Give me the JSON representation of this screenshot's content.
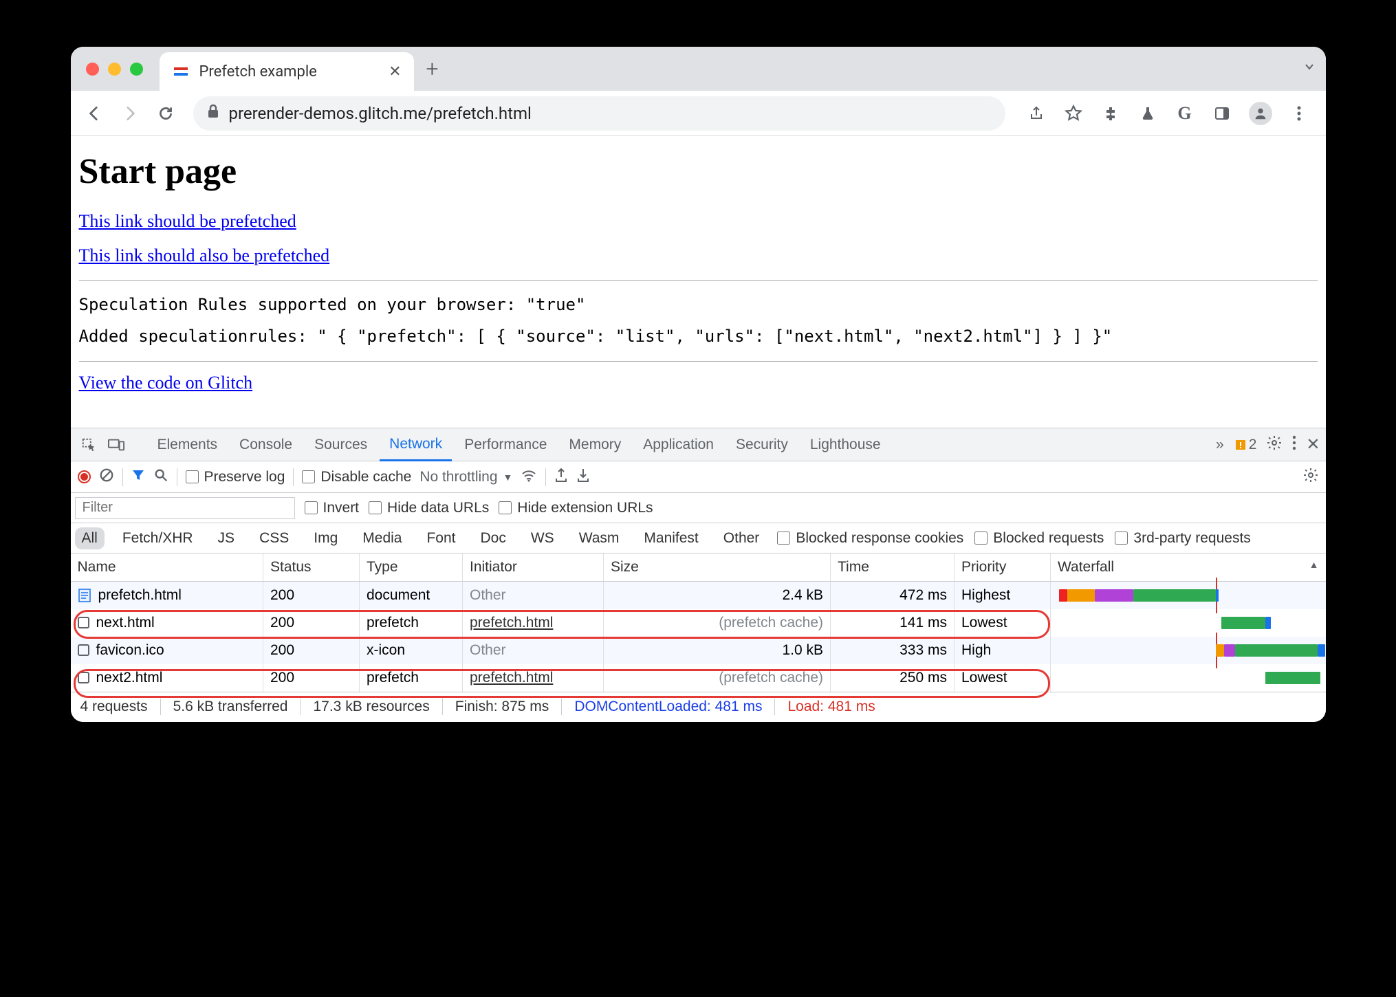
{
  "tab": {
    "title": "Prefetch example"
  },
  "url": "prerender-demos.glitch.me/prefetch.html",
  "page": {
    "heading": "Start page",
    "link1": "This link should be prefetched",
    "link2": "This link should also be prefetched",
    "code1": "Speculation Rules supported on your browser: \"true\"",
    "code2": "Added speculationrules: \" { \"prefetch\": [ { \"source\": \"list\", \"urls\": [\"next.html\", \"next2.html\"] } ] }\"",
    "link3": "View the code on Glitch"
  },
  "devtools": {
    "tabs": {
      "elements": "Elements",
      "console": "Console",
      "sources": "Sources",
      "network": "Network",
      "performance": "Performance",
      "memory": "Memory",
      "application": "Application",
      "security": "Security",
      "lighthouse": "Lighthouse"
    },
    "issues_count": "2",
    "toolbar": {
      "preserve": "Preserve log",
      "disable_cache": "Disable cache",
      "throttling": "No throttling"
    },
    "filter": {
      "placeholder": "Filter",
      "invert": "Invert",
      "hide_data": "Hide data URLs",
      "hide_ext": "Hide extension URLs"
    },
    "types": {
      "all": "All",
      "fetch": "Fetch/XHR",
      "js": "JS",
      "css": "CSS",
      "img": "Img",
      "media": "Media",
      "font": "Font",
      "doc": "Doc",
      "ws": "WS",
      "wasm": "Wasm",
      "manifest": "Manifest",
      "other": "Other",
      "blocked_cookies": "Blocked response cookies",
      "blocked_req": "Blocked requests",
      "third_party": "3rd-party requests"
    },
    "columns": {
      "name": "Name",
      "status": "Status",
      "type": "Type",
      "initiator": "Initiator",
      "size": "Size",
      "time": "Time",
      "priority": "Priority",
      "waterfall": "Waterfall"
    },
    "rows": [
      {
        "name": "prefetch.html",
        "status": "200",
        "type": "document",
        "initiator": "Other",
        "initiator_muted": true,
        "size": "2.4 kB",
        "size_muted": false,
        "time": "472 ms",
        "priority": "Highest",
        "icon": "doc"
      },
      {
        "name": "next.html",
        "status": "200",
        "type": "prefetch",
        "initiator": "prefetch.html",
        "initiator_muted": false,
        "size": "(prefetch cache)",
        "size_muted": true,
        "time": "141 ms",
        "priority": "Lowest",
        "icon": "box"
      },
      {
        "name": "favicon.ico",
        "status": "200",
        "type": "x-icon",
        "initiator": "Other",
        "initiator_muted": true,
        "size": "1.0 kB",
        "size_muted": false,
        "time": "333 ms",
        "priority": "High",
        "icon": "box"
      },
      {
        "name": "next2.html",
        "status": "200",
        "type": "prefetch",
        "initiator": "prefetch.html",
        "initiator_muted": false,
        "size": "(prefetch cache)",
        "size_muted": true,
        "time": "250 ms",
        "priority": "Lowest",
        "icon": "box"
      }
    ],
    "status": {
      "requests": "4 requests",
      "transferred": "5.6 kB transferred",
      "resources": "17.3 kB resources",
      "finish": "Finish: 875 ms",
      "dcl": "DOMContentLoaded: 481 ms",
      "load": "Load: 481 ms"
    }
  }
}
